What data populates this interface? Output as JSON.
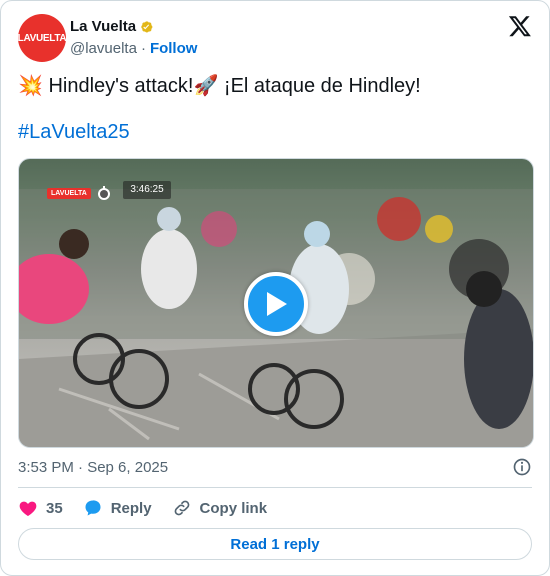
{
  "account": {
    "avatar_text": "LAVUELTA",
    "display_name": "La Vuelta",
    "handle": "@lavuelta",
    "separator": "·",
    "follow_label": "Follow"
  },
  "tweet": {
    "text": "💥 Hindley's attack!🚀 ¡El ataque de Hindley!",
    "hashtag": "#LaVuelta25",
    "timestamp": "3:53 PM · Sep 6, 2025"
  },
  "media": {
    "overlay_brand": "LAVUELTA",
    "overlay_timer": "3:46:25"
  },
  "actions": {
    "likes": "35",
    "reply_label": "Reply",
    "copy_link_label": "Copy link"
  },
  "footer": {
    "read_reply_label": "Read 1 reply"
  },
  "colors": {
    "accent": "#1d9bf0",
    "link": "#006fd6",
    "brand": "#e8312c",
    "like": "#f91880",
    "muted": "#536471"
  }
}
